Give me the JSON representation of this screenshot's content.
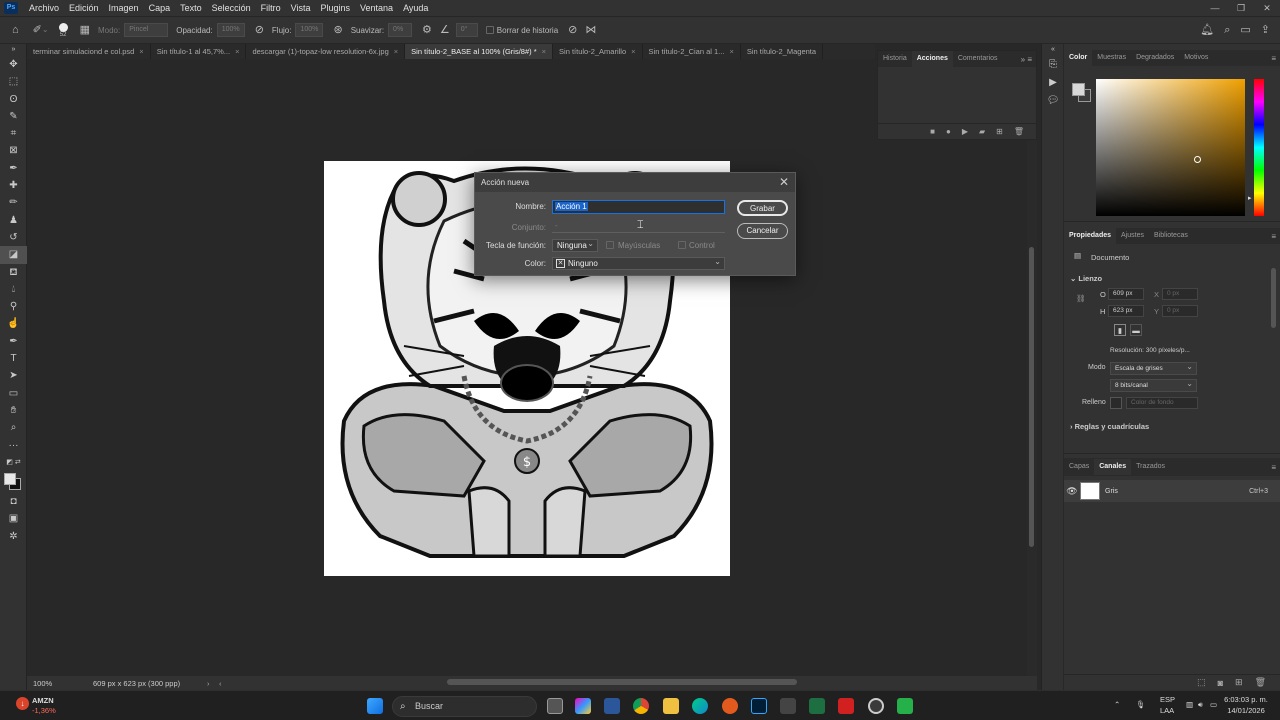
{
  "menubar": {
    "app_icon": "Ps",
    "items": [
      "Archivo",
      "Edición",
      "Imagen",
      "Capa",
      "Texto",
      "Selección",
      "Filtro",
      "Vista",
      "Plugins",
      "Ventana",
      "Ayuda"
    ]
  },
  "options_bar": {
    "brush_size": "52",
    "mode_label": "Modo:",
    "mode_value": "Pincel",
    "opacity_label": "Opacidad:",
    "opacity_value": "100%",
    "flow_label": "Flujo:",
    "flow_value": "100%",
    "smooth_label": "Suavizar:",
    "smooth_value": "0%",
    "angle_value": "0°",
    "erase_history_label": "Borrar de historia"
  },
  "tabs": [
    {
      "label": "terminar simulaciond e col.psd",
      "active": false
    },
    {
      "label": "Sin título-1 al 45,7%...",
      "active": false
    },
    {
      "label": "descargar (1)-topaz-low resolution-6x.jpg",
      "active": false
    },
    {
      "label": "Sin título-2_BASE al 100% (Gris/8#) *",
      "active": true
    },
    {
      "label": "Sin título-2_Amarillo",
      "active": false
    },
    {
      "label": "Sin título-2_Cian al 1...",
      "active": false
    },
    {
      "label": "Sin título-2_Magenta",
      "active": false
    }
  ],
  "status": {
    "zoom": "100%",
    "doc_info": "609 px x 623 px (300 ppp)"
  },
  "history_panel": {
    "tabs": [
      "Historia",
      "Acciones",
      "Comentarios"
    ],
    "active": "Acciones"
  },
  "color_panel": {
    "tabs": [
      "Color",
      "Muestras",
      "Degradados",
      "Motivos"
    ],
    "active": "Color",
    "picked_hue": "#f0a000",
    "foreground": "#d8d8d8",
    "background": "#3a3a3a"
  },
  "properties_panel": {
    "tabs": [
      "Propiedades",
      "Ajustes",
      "Bibliotecas"
    ],
    "active": "Propiedades",
    "doc_label": "Documento",
    "section_lienzo": "Lienzo",
    "width_label": "O",
    "width_value": "609 px",
    "x_label": "X",
    "x_value": "0 px",
    "height_label": "H",
    "height_value": "623 px",
    "y_label": "Y",
    "y_value": "0 px",
    "resolution": "Resolución: 300 píxeles/p...",
    "mode_label": "Modo",
    "mode_value": "Escala de grises",
    "bits_value": "8 bits/canal",
    "fill_label": "Relleno",
    "fill_value": "Color de fondo",
    "section_rules": "Reglas y cuadrículas"
  },
  "layers_panel": {
    "tabs": [
      "Capas",
      "Canales",
      "Trazados"
    ],
    "active": "Canales",
    "channel_name": "Gris",
    "channel_shortcut": "Ctrl+3"
  },
  "dialog": {
    "title": "Acción nueva",
    "name_label": "Nombre:",
    "name_value": "Acción 1",
    "set_label": "Conjunto:",
    "set_value": "-",
    "fkey_label": "Tecla de función:",
    "fkey_value": "Ninguna",
    "shift_label": "Mayúsculas",
    "control_label": "Control",
    "color_label": "Color:",
    "color_value": "Ninguno",
    "record_button": "Grabar",
    "cancel_button": "Cancelar"
  },
  "taskbar": {
    "stock_symbol": "AMZN",
    "stock_change": "-1,36%",
    "search_placeholder": "Buscar",
    "lang_1": "ESP",
    "lang_2": "LAA",
    "time": "6:03:03 p. m.",
    "date": "14/01/2026"
  }
}
